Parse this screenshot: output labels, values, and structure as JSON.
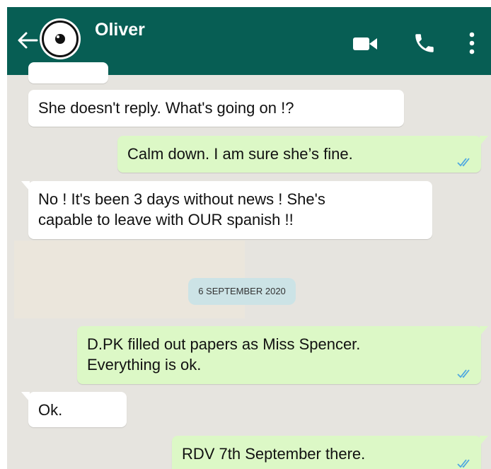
{
  "header": {
    "contact_name": "Oliver",
    "back_icon": "arrow-left-icon",
    "avatar_icon": "eye-avatar",
    "video_icon": "video-camera-icon",
    "call_icon": "phone-icon",
    "menu_icon": "more-vertical-icon",
    "color": "#075e54"
  },
  "messages": [
    {
      "direction": "incoming",
      "text": "She doesn't reply. What's going on !?"
    },
    {
      "direction": "outgoing",
      "text": "Calm down. I am sure she’s fine.",
      "status": "read"
    },
    {
      "direction": "incoming",
      "lines": [
        "No ! It's been 3 days without news ! She's",
        "capable to leave with OUR spanish !!"
      ]
    },
    {
      "direction": "outgoing",
      "lines": [
        "D.PK filled out papers as Miss Spencer.",
        "Everything is ok."
      ],
      "status": "read"
    },
    {
      "direction": "incoming",
      "text": "Ok."
    },
    {
      "direction": "outgoing",
      "text": "RDV 7th September there.",
      "status": "read"
    }
  ],
  "date_separator": "6 SEPTEMBER 2020",
  "colors": {
    "outgoing_bubble": "#dcf8c6",
    "incoming_bubble": "#ffffff",
    "chat_background": "#e6e4df",
    "read_ticks": "#4fa8e0"
  }
}
